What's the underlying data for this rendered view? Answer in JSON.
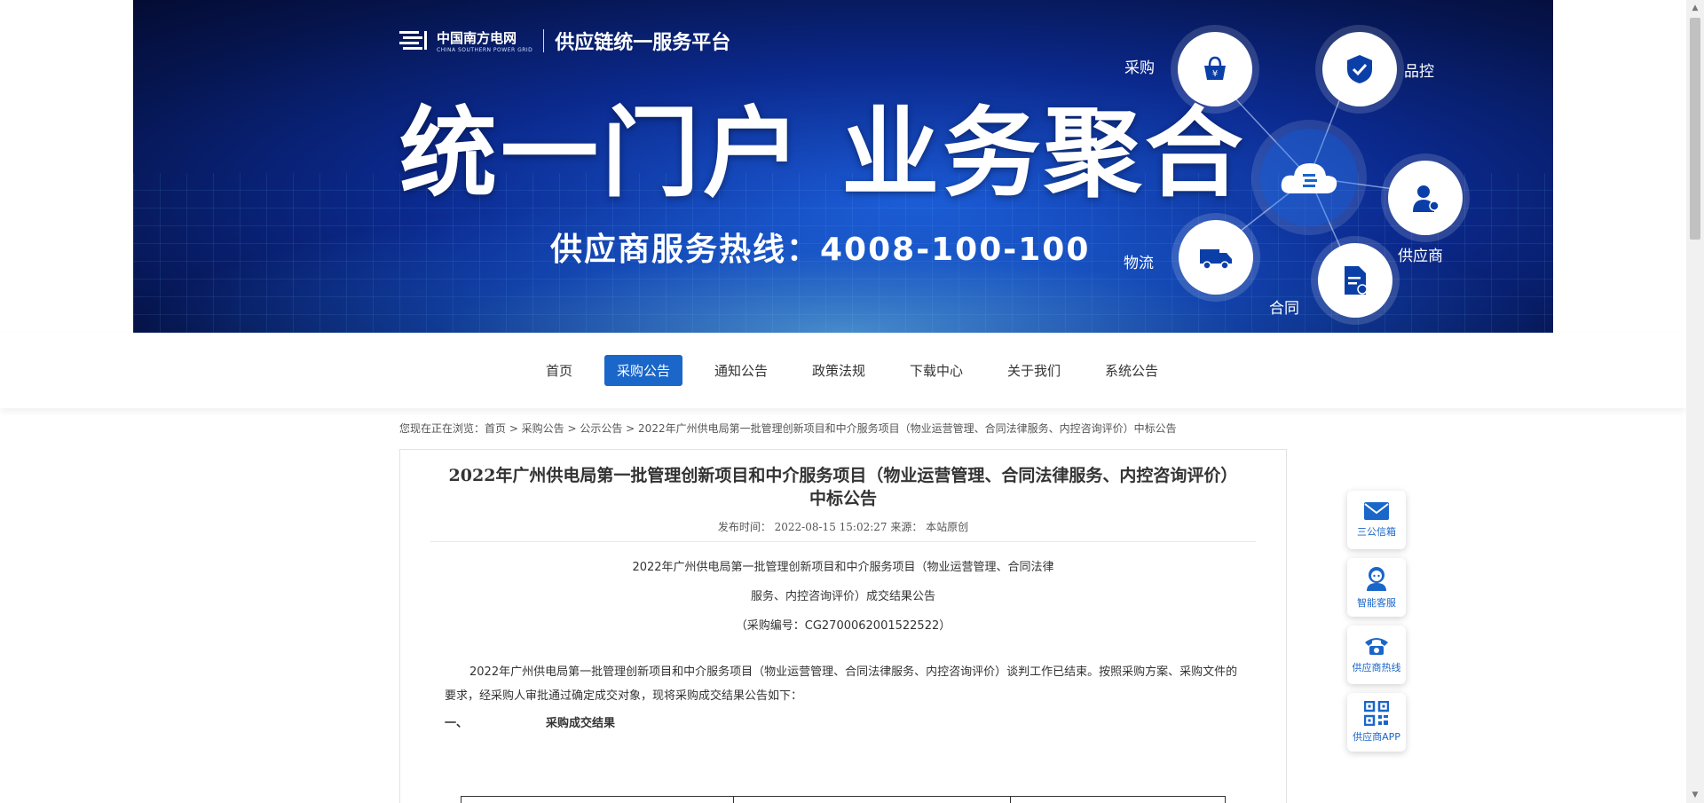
{
  "banner": {
    "logo_cn": "中国南方电网",
    "logo_en": "CHINA SOUTHERN POWER GRID",
    "platform_name": "供应链统一服务平台",
    "headline": "统一门户  业务聚合",
    "hotline": "供应商服务热线：4008-100-100",
    "nodes": {
      "purchase": "采购",
      "quality": "品控",
      "supplier": "供应商",
      "contract": "合同",
      "logistics": "物流"
    }
  },
  "nav": {
    "items": [
      "首页",
      "采购公告",
      "通知公告",
      "政策法规",
      "下载中心",
      "关于我们",
      "系统公告"
    ],
    "active_index": 1
  },
  "breadcrumb": "您现在正在浏览：首页 > 采购公告 > 公示公告 > 2022年广州供电局第一批管理创新项目和中介服务项目（物业运营管理、合同法律服务、内控咨询评价）中标公告",
  "article": {
    "title_line1": "2022年广州供电局第一批管理创新项目和中介服务项目（物业运营管理、合同法律服务、内控咨询评价）",
    "title_line2": "中标公告",
    "meta": "发布时间： 2022-08-15 15:02:27  来源： 本站原创",
    "center_line1": "2022年广州供电局第一批管理创新项目和中介服务项目（物业运营管理、合同法律",
    "center_line2": "服务、内控咨询评价）成交结果公告",
    "center_line3": "（采购编号：CG2700062001522522）",
    "paragraph": "2022年广州供电局第一批管理创新项目和中介服务项目（物业运营管理、合同法律服务、内控咨询评价）谈判工作已结束。按照采购方案、采购文件的要求，经采购人审批通过确定成交对象，现将采购成交结果公告如下：",
    "section_num": "一、",
    "section_title": "采购成交结果"
  },
  "side_buttons": [
    {
      "label": "三公信箱",
      "icon": "mail-icon"
    },
    {
      "label": "智能客服",
      "icon": "customer-service-icon"
    },
    {
      "label": "供应商热线",
      "icon": "phone-icon"
    },
    {
      "label": "供应商APP",
      "icon": "qrcode-icon"
    }
  ],
  "colors": {
    "accent": "#1a66c9",
    "banner_dark": "#06154f"
  }
}
